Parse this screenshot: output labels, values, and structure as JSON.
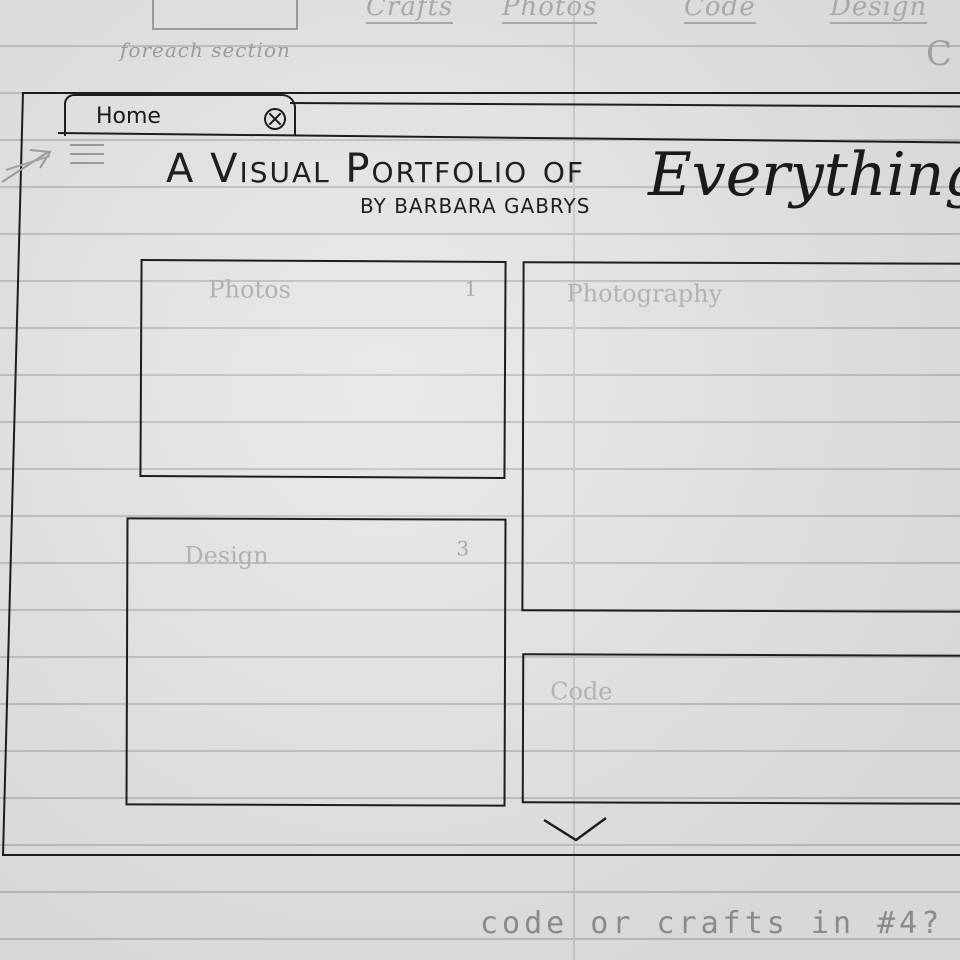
{
  "sketch": {
    "top_nav": [
      "Crafts",
      "Photos",
      "Code",
      "Design"
    ],
    "foreach_note": "foreach section",
    "corner_letter": "C"
  },
  "browser": {
    "tab_label": "Home"
  },
  "header": {
    "title": "A Visual Portfolio of",
    "title_script": "Everything",
    "byline": "BY BARBARA GABRYS"
  },
  "tiles": [
    {
      "label": "Photos",
      "number": "1"
    },
    {
      "label": "Photography",
      "number": ""
    },
    {
      "label": "Design",
      "number": "3"
    },
    {
      "label": "Code",
      "number": ""
    }
  ],
  "bottom_note": "code or crafts in #4?",
  "colors": {
    "ink": "#1d1d1d",
    "pencil": "#9a9a9a",
    "paper": "#e6e5e1"
  }
}
